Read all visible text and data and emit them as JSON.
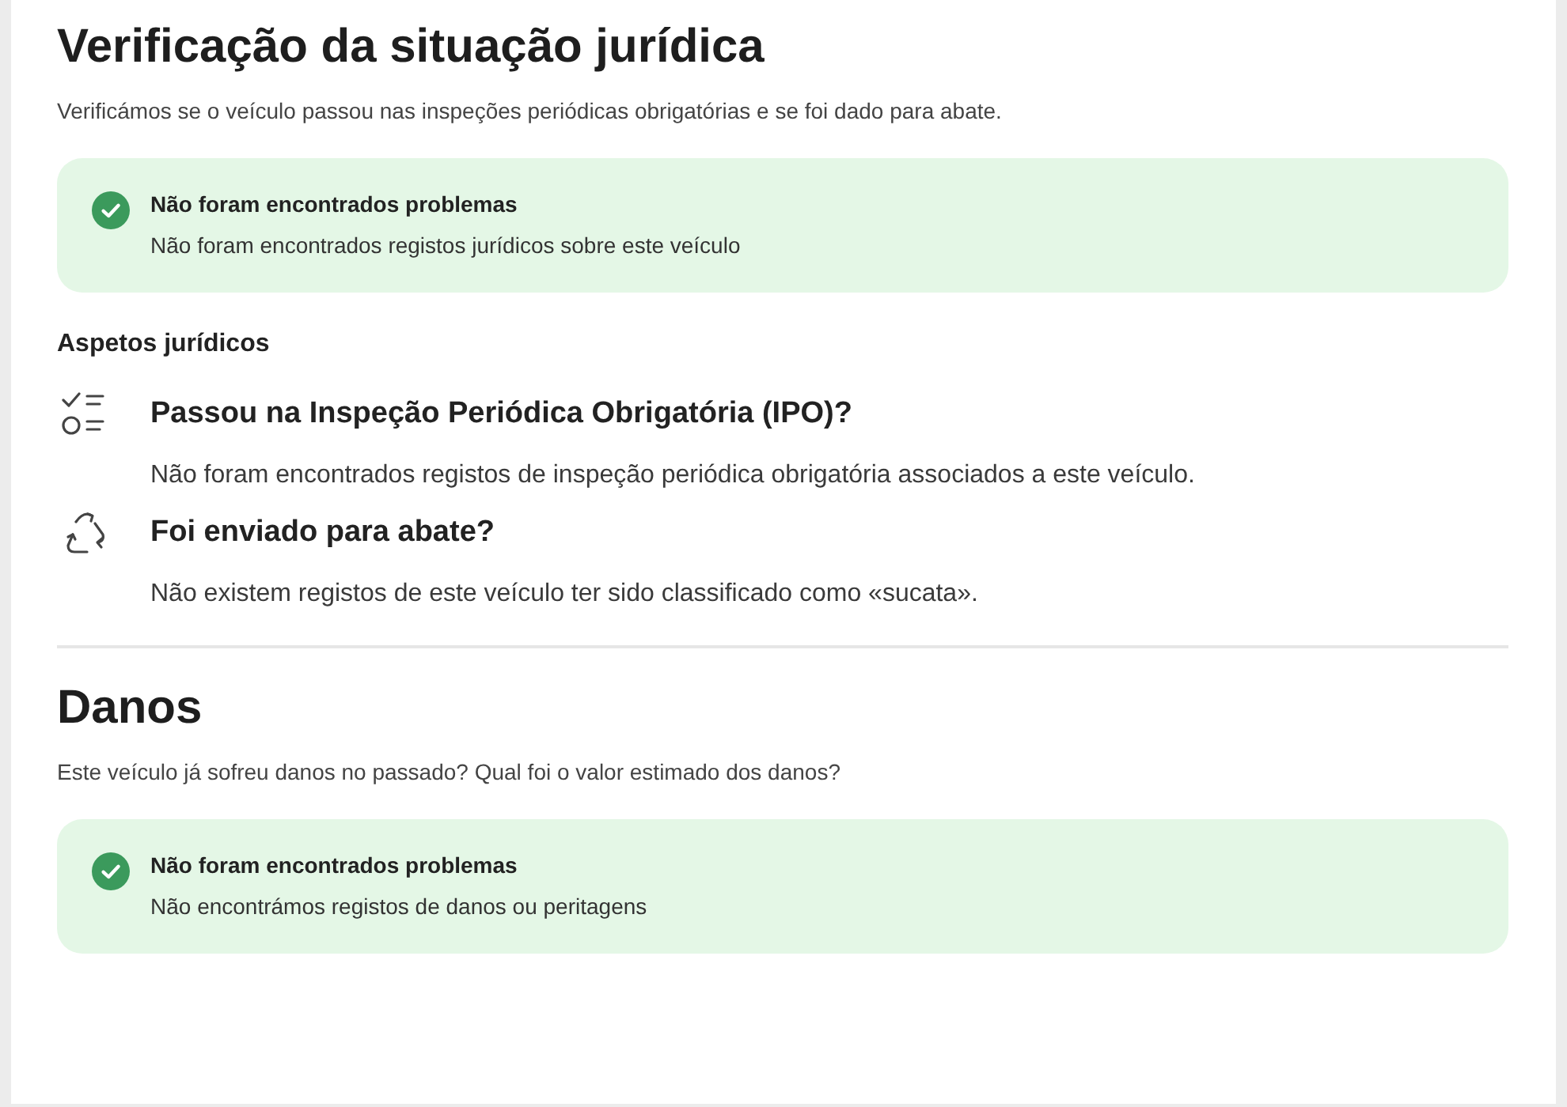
{
  "sections": [
    {
      "title": "Verificação da situação jurídica",
      "description": "Verificámos se o veículo passou nas inspeções periódicas obrigatórias e se foi dado para abate.",
      "alert": {
        "kind": "success",
        "title": "Não foram encontrados problemas",
        "message": "Não foram encontrados registos jurídicos sobre este veículo"
      },
      "subsection": {
        "title": "Aspetos jurídicos",
        "items": [
          {
            "kind": "checklist",
            "question": "Passou na Inspeção Periódica Obrigatória (IPO)?",
            "answer": "Não foram encontrados registos de inspeção periódica obrigatória associados a este veículo."
          },
          {
            "kind": "recycle",
            "question": "Foi enviado para abate?",
            "answer": "Não existem registos de este veículo ter sido classificado como «sucata»."
          }
        ]
      }
    },
    {
      "title": "Danos",
      "description": "Este veículo já sofreu danos no passado? Qual foi o valor estimado dos danos?",
      "alert": {
        "kind": "success",
        "title": "Não foram encontrados problemas",
        "message": "Não encontrámos registos de danos ou peritagens"
      }
    }
  ]
}
